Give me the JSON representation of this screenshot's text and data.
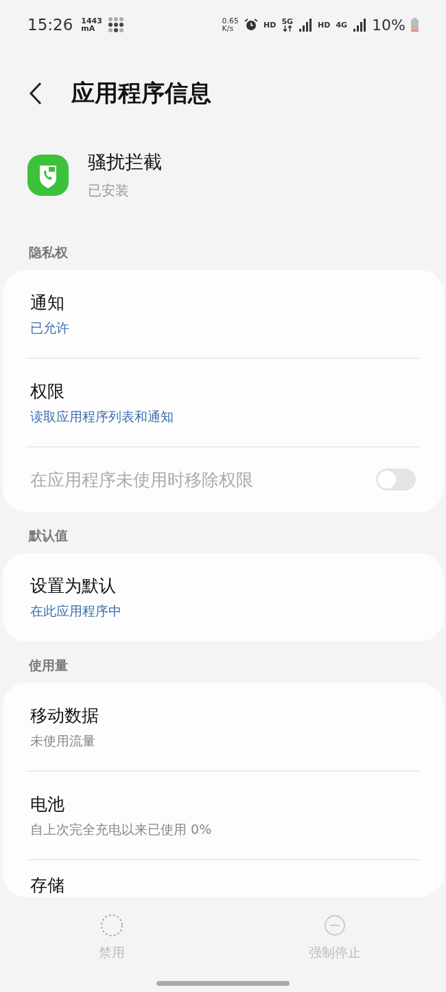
{
  "status_bar": {
    "time": "15:26",
    "current_value": "1443",
    "current_unit": "mA",
    "speed_value": "0.65",
    "speed_unit": "K/s",
    "hd_1": "HD",
    "network_1": "5G",
    "hd_2": "HD",
    "network_2": "4G",
    "battery": "10%"
  },
  "header": {
    "title": "应用程序信息"
  },
  "app": {
    "name": "骚扰拦截",
    "status": "已安装"
  },
  "sections": [
    {
      "title": "隐私权",
      "rows": [
        {
          "kind": "link",
          "title": "通知",
          "subtitle": "已允许",
          "accent": true
        },
        {
          "kind": "link",
          "title": "权限",
          "subtitle": "读取应用程序列表和通知",
          "accent": true
        },
        {
          "kind": "toggle",
          "title": "在应用程序未使用时移除权限",
          "on": false,
          "disabled": true
        }
      ]
    },
    {
      "title": "默认值",
      "rows": [
        {
          "kind": "link",
          "title": "设置为默认",
          "subtitle": "在此应用程序中",
          "accent": true
        }
      ]
    },
    {
      "title": "使用量",
      "rows": [
        {
          "kind": "link",
          "title": "移动数据",
          "subtitle": "未使用流量",
          "accent": false
        },
        {
          "kind": "link",
          "title": "电池",
          "subtitle": "自上次完全充电以来已使用 0%",
          "accent": false
        },
        {
          "kind": "link",
          "title": "存储"
        }
      ]
    }
  ],
  "bottom_actions": [
    {
      "label": "禁用",
      "disabled": true
    },
    {
      "label": "强制停止",
      "disabled": true
    }
  ]
}
